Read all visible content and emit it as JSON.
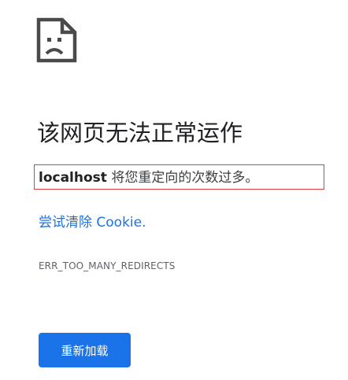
{
  "icon": "sad-document-icon",
  "heading": "该网页无法正常运作",
  "error": {
    "host": "localhost",
    "message": " 将您重定向的次数过多。"
  },
  "suggestion": {
    "link": "尝试清除 Cookie."
  },
  "error_code": "ERR_TOO_MANY_REDIRECTS",
  "reload_button": "重新加载",
  "colors": {
    "heading": "#202124",
    "link": "#1a73e8",
    "button": "#1a73e8",
    "highlight_border": "#e0393e"
  }
}
